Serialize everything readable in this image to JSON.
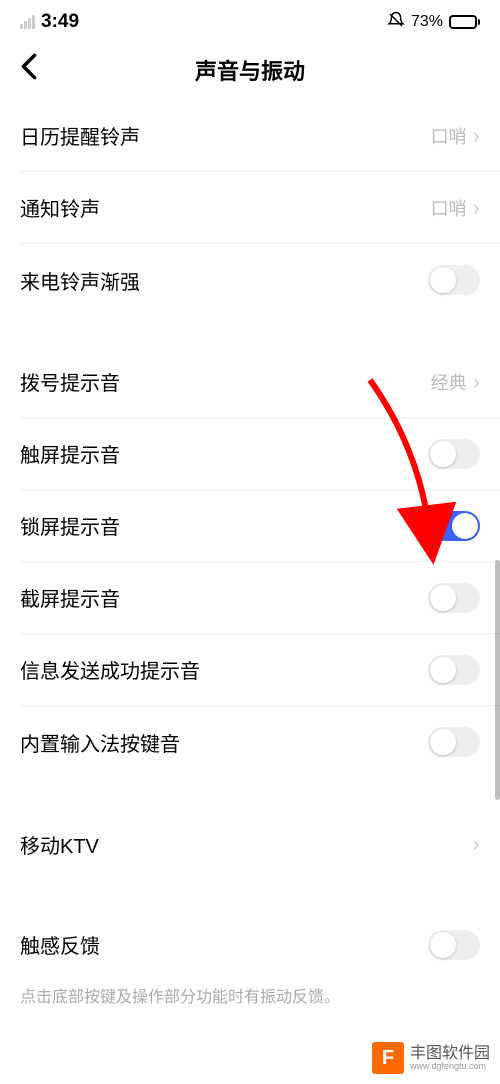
{
  "status": {
    "time": "3:49",
    "battery_pct": "73%"
  },
  "header": {
    "title": "声音与振动"
  },
  "rows": {
    "calendar_ringtone": {
      "label": "日历提醒铃声",
      "value": "口哨"
    },
    "notification_ringtone": {
      "label": "通知铃声",
      "value": "口哨"
    },
    "incoming_crescendo": {
      "label": "来电铃声渐强"
    },
    "dial_tone": {
      "label": "拨号提示音",
      "value": "经典"
    },
    "touch_sound": {
      "label": "触屏提示音"
    },
    "lock_sound": {
      "label": "锁屏提示音"
    },
    "screenshot_sound": {
      "label": "截屏提示音"
    },
    "sms_sent_sound": {
      "label": "信息发送成功提示音"
    },
    "ime_key_sound": {
      "label": "内置输入法按键音"
    },
    "mobile_ktv": {
      "label": "移动KTV"
    },
    "haptic": {
      "label": "触感反馈",
      "subtext": "点击底部按键及操作部分功能时有振动反馈。"
    }
  },
  "watermark": {
    "logo": "F",
    "name": "丰图软件园",
    "site": "www.dgfengtu.com"
  }
}
